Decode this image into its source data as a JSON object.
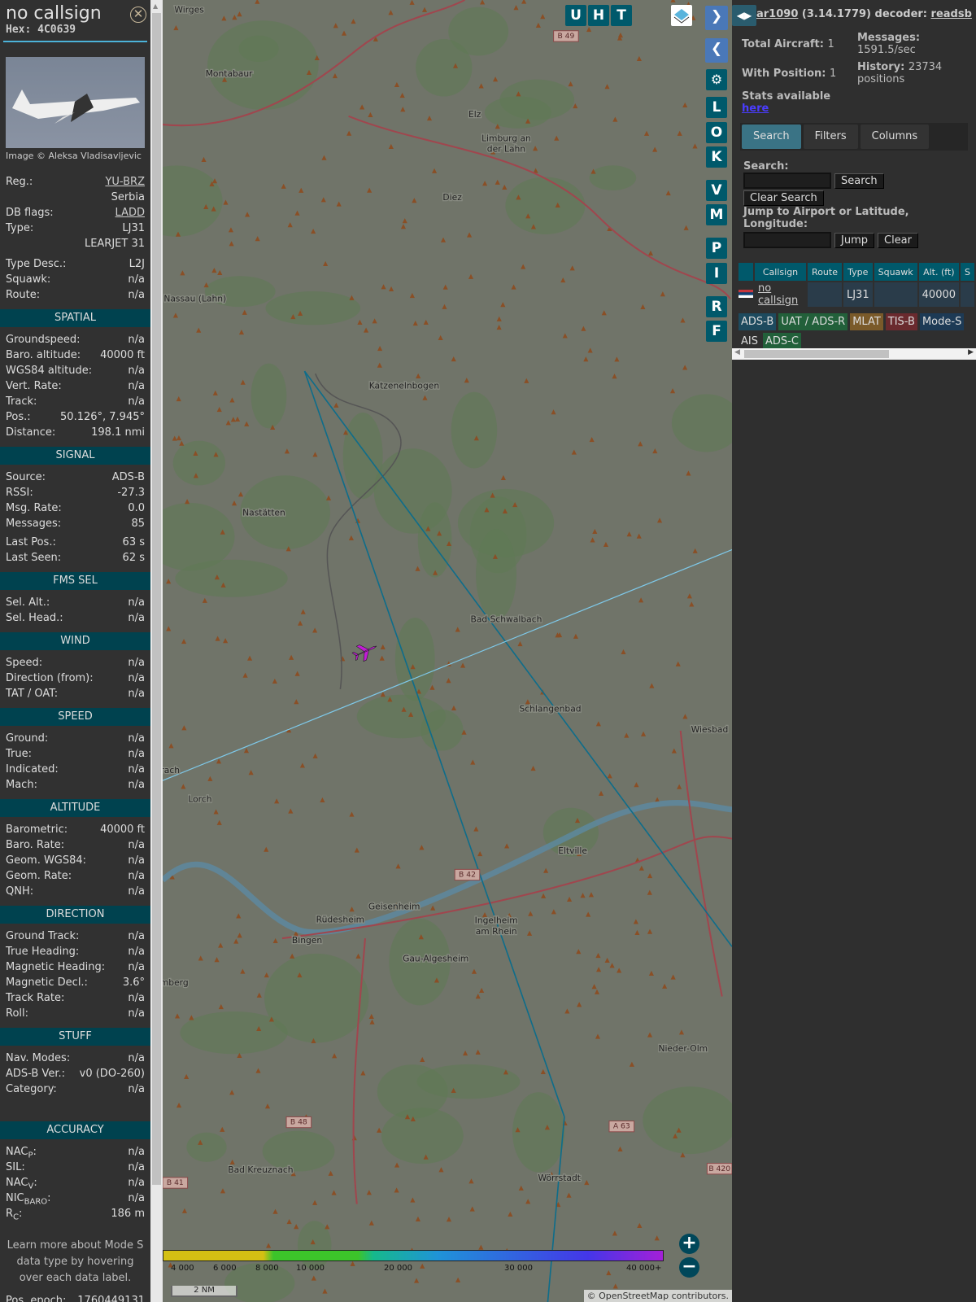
{
  "aircraft": {
    "title": "no callsign",
    "hex": "Hex: 4C0639",
    "photo_credit": "Image © Aleksa Vladisavljevic",
    "info": [
      {
        "label": "Reg.:",
        "value": "YU-BRZ",
        "link": true
      },
      {
        "label": "",
        "value": "Serbia"
      },
      {
        "label": "DB flags:",
        "value": "LADD",
        "link": true
      },
      {
        "label": "Type:",
        "value": "LJ31"
      },
      {
        "label": "",
        "value": "LEARJET 31"
      },
      {
        "label": "Type Desc.:",
        "value": "L2J"
      },
      {
        "label": "Squawk:",
        "value": "n/a"
      },
      {
        "label": "Route:",
        "value": "n/a"
      }
    ],
    "sections": [
      {
        "title": "SPATIAL",
        "rows": [
          {
            "label": "Groundspeed:",
            "value": "n/a"
          },
          {
            "label": "Baro. altitude:",
            "value": "40000 ft"
          },
          {
            "label": "WGS84 altitude:",
            "value": "n/a"
          },
          {
            "label": "Vert. Rate:",
            "value": "n/a"
          },
          {
            "label": "Track:",
            "value": "n/a"
          },
          {
            "label": "Pos.:",
            "value": "50.126°, 7.945°"
          },
          {
            "label": "Distance:",
            "value": "198.1 nmi"
          }
        ]
      },
      {
        "title": "SIGNAL",
        "rows": [
          {
            "label": "Source:",
            "value": "ADS-B"
          },
          {
            "label": "RSSI:",
            "value": "-27.3"
          },
          {
            "label": "Msg. Rate:",
            "value": "0.0"
          },
          {
            "label": "Messages:",
            "value": "85"
          },
          {
            "label": "Last Pos.:",
            "value": "63 s"
          },
          {
            "label": "Last Seen:",
            "value": "62 s"
          }
        ]
      },
      {
        "title": "FMS SEL",
        "rows": [
          {
            "label": "Sel. Alt.:",
            "value": "n/a"
          },
          {
            "label": "Sel. Head.:",
            "value": "n/a"
          }
        ]
      },
      {
        "title": "WIND",
        "rows": [
          {
            "label": "Speed:",
            "value": "n/a"
          },
          {
            "label": "Direction (from):",
            "value": "n/a"
          },
          {
            "label": "TAT / OAT:",
            "value": "n/a"
          }
        ]
      },
      {
        "title": "SPEED",
        "rows": [
          {
            "label": "Ground:",
            "value": "n/a"
          },
          {
            "label": "True:",
            "value": "n/a"
          },
          {
            "label": "Indicated:",
            "value": "n/a"
          },
          {
            "label": "Mach:",
            "value": "n/a"
          }
        ]
      },
      {
        "title": "ALTITUDE",
        "rows": [
          {
            "label": "Barometric:",
            "value": "40000 ft"
          },
          {
            "label": "Baro. Rate:",
            "value": "n/a"
          },
          {
            "label": "Geom. WGS84:",
            "value": "n/a"
          },
          {
            "label": "Geom. Rate:",
            "value": "n/a"
          },
          {
            "label": "QNH:",
            "value": "n/a"
          }
        ]
      },
      {
        "title": "DIRECTION",
        "rows": [
          {
            "label": "Ground Track:",
            "value": "n/a"
          },
          {
            "label": "True Heading:",
            "value": "n/a"
          },
          {
            "label": "Magnetic Heading:",
            "value": "n/a"
          },
          {
            "label": "Magnetic Decl.:",
            "value": "3.6°"
          },
          {
            "label": "Track Rate:",
            "value": "n/a"
          },
          {
            "label": "Roll:",
            "value": "n/a"
          }
        ]
      },
      {
        "title": "STUFF",
        "rows": [
          {
            "label": "Nav. Modes:",
            "value": "n/a"
          },
          {
            "label": "ADS-B Ver.:",
            "value": "v0 (DO-260)"
          },
          {
            "label": "Category:",
            "value": "n/a"
          }
        ]
      },
      {
        "title": "ACCURACY",
        "rows": [
          {
            "label": "NAC",
            "sub": "P",
            "value": "n/a"
          },
          {
            "label": "SIL",
            "sub": "",
            "value": "n/a"
          },
          {
            "label": "NAC",
            "sub": "V",
            "value": "n/a"
          },
          {
            "label": "NIC",
            "sub": "BARO",
            "value": "n/a"
          },
          {
            "label": "R",
            "sub": "C",
            "value": "186 m"
          }
        ]
      }
    ],
    "note": "Learn more about Mode S data type by hovering over each data label.",
    "epoch_label": "Pos. epoch:",
    "epoch_value": "1760449131"
  },
  "map": {
    "buttons_top": [
      "U",
      "H",
      "T"
    ],
    "buttons_side": [
      "L",
      "O",
      "K",
      "V",
      "M",
      "P",
      "I",
      "R",
      "F"
    ],
    "towns": [
      "Wirges",
      "Montabaur",
      "Elz",
      "Limburg an",
      "der Lahn",
      "Diez",
      "Nassau (Lahn)",
      "Katzenelnbogen",
      "Nastätten",
      "Bad Schwalbach",
      "Schlangenbad",
      "Wiesbad",
      "Lorch",
      "Eltville",
      "Geisenheim",
      "Rüdesheim",
      "Bingen",
      "Ingelheim",
      "am Rhein",
      "Gau-Algesheim",
      "Nieder-Olm",
      "Bad Kreuznach",
      "Wörrstadt",
      "rach",
      "mberg"
    ],
    "roads": [
      "B 49",
      "B 42",
      "B 48",
      "B 41",
      "A 63",
      "B 420"
    ],
    "legend": [
      "4 000",
      "6 000",
      "8 000",
      "10 000",
      "20 000",
      "30 000",
      "40 000+"
    ],
    "scale": "2 NM",
    "attribution": "© OpenStreetMap contributors."
  },
  "right": {
    "app": "ar1090",
    "version": "(3.14.1779) decoder:",
    "decoder": "readsb",
    "total_label": "Total Aircraft:",
    "total": "1",
    "pos_label": "With Position:",
    "pos": "1",
    "msg_label": "Messages:",
    "msg": "1591.5/sec",
    "hist_label": "History:",
    "hist": "23734",
    "hist_unit": "positions",
    "stats_label": "Stats available",
    "stats_link": "here",
    "tabs": [
      "Search",
      "Filters",
      "Columns"
    ],
    "search_label": "Search:",
    "search_btn": "Search",
    "clear_search": "Clear Search",
    "jump_label": "Jump to Airport or Latitude, Longitude:",
    "jump_btn": "Jump",
    "clear_btn": "Clear",
    "columns": [
      "",
      "Callsign",
      "Route",
      "Type",
      "Squawk",
      "Alt. (ft)",
      "S"
    ],
    "row": {
      "callsign": "no callsign",
      "route": "",
      "type": "LJ31",
      "squawk": "",
      "alt": "40000"
    },
    "sources": [
      {
        "name": "ADS-B",
        "color": "#1d4a5e"
      },
      {
        "name": "UAT / ADS-R",
        "color": "#22603a"
      },
      {
        "name": "MLAT",
        "color": "#7a5a2a"
      },
      {
        "name": "TIS-B",
        "color": "#6a2a2e"
      },
      {
        "name": "Mode-S",
        "color": "#1d3a55"
      },
      {
        "name": "AIS",
        "color": "#2f2f2f"
      },
      {
        "name": "ADS-C",
        "color": "#22603a"
      }
    ]
  }
}
